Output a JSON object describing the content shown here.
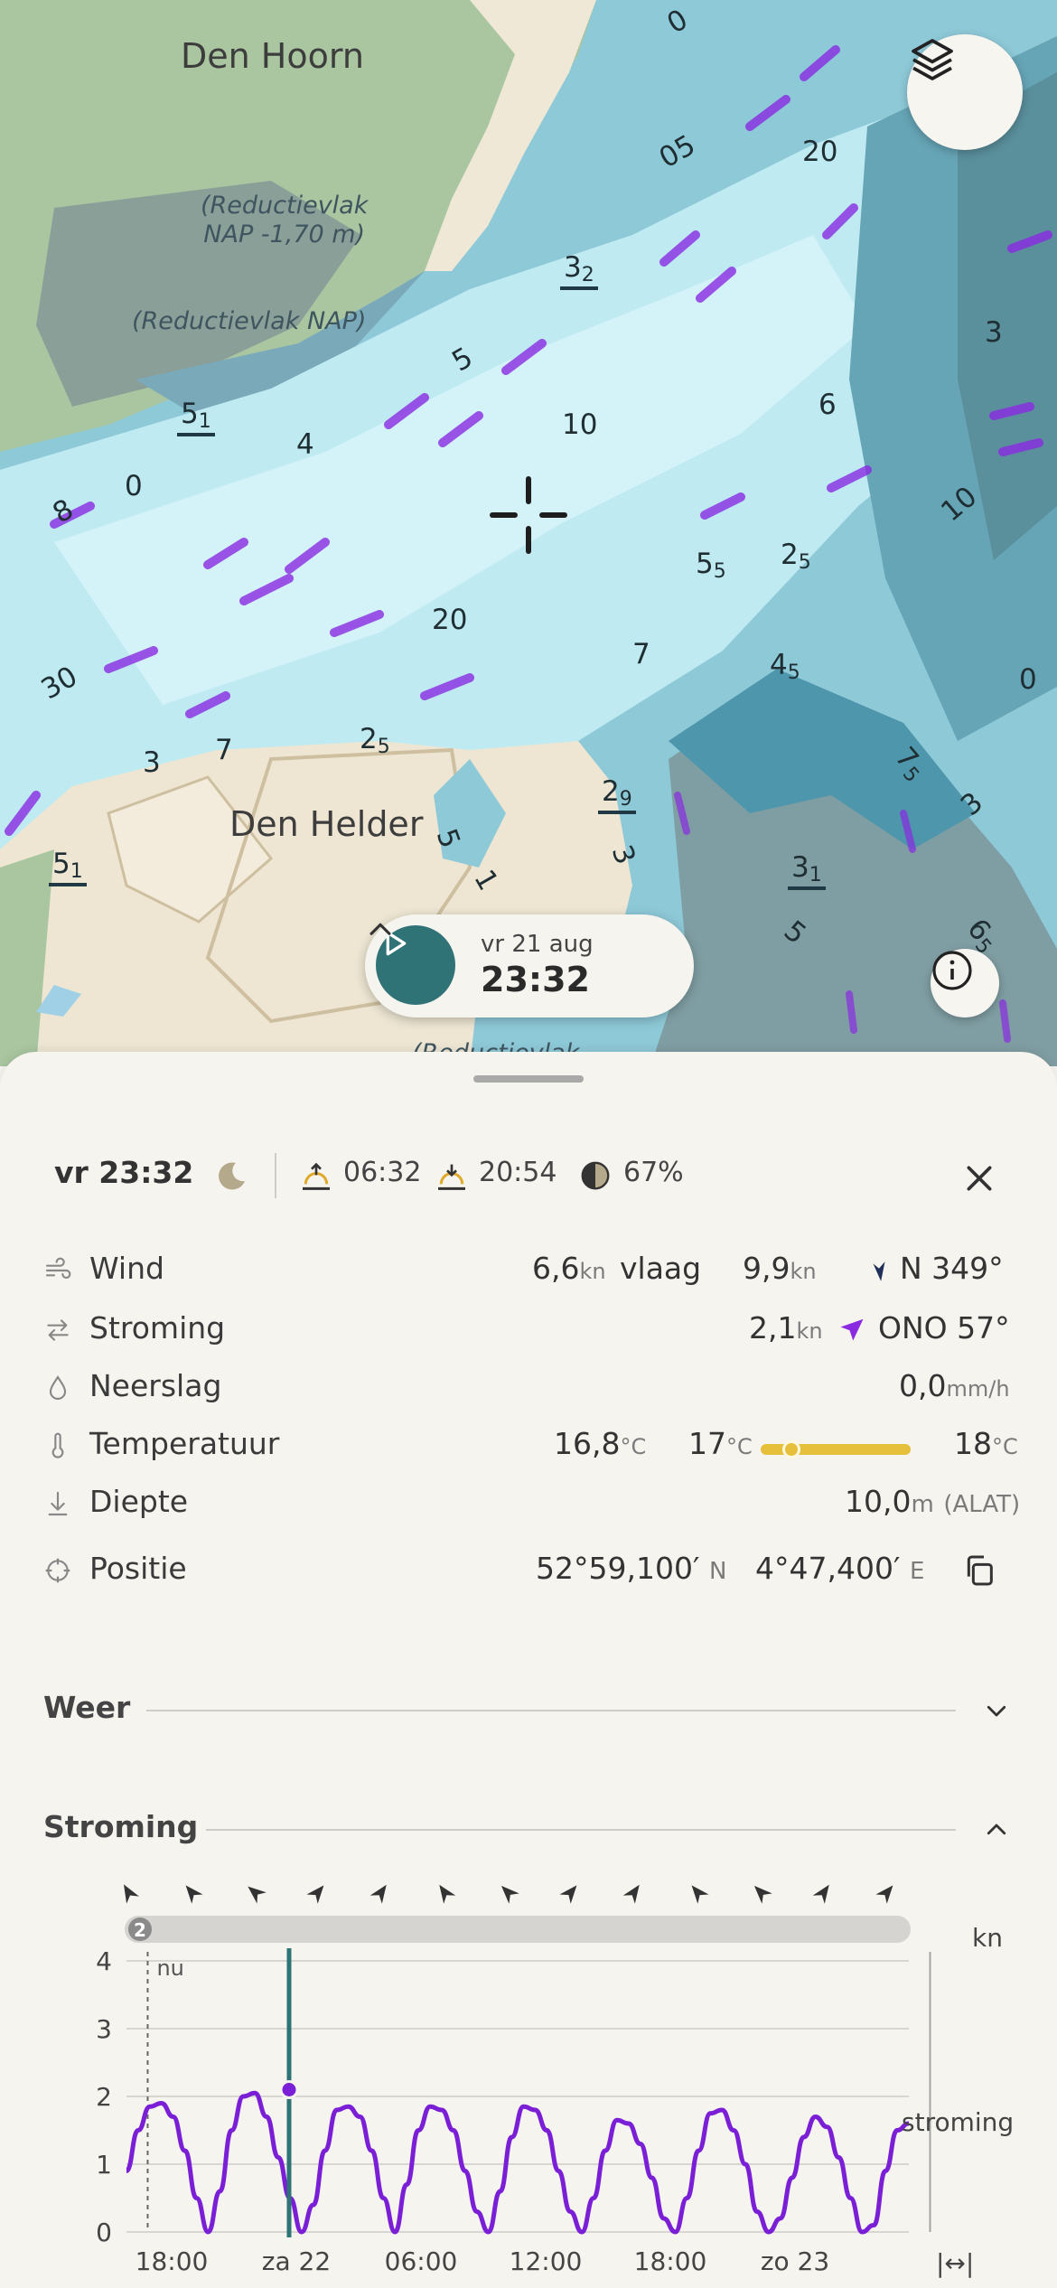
{
  "map": {
    "places": [
      {
        "name": "Den Hoorn"
      },
      {
        "name": "Den Helder"
      }
    ],
    "reduction_labels": [
      {
        "text": "(Reductievlak\nNAP -1,70 m)"
      },
      {
        "text": "(Reductievlak NAP)"
      },
      {
        "text": "(Reductievlak"
      }
    ],
    "depths": [
      "0",
      "5",
      "20",
      "3",
      "2",
      "5",
      "5",
      "10",
      "6",
      "3",
      "5",
      "1",
      "4",
      "0",
      "8",
      "6",
      "5",
      "10",
      "5",
      "5",
      "2",
      "5",
      "20",
      "7",
      "4",
      "5",
      "0",
      "30",
      "3",
      "7",
      "2",
      "5",
      "7",
      "5",
      "2",
      "9",
      "3",
      "5",
      "3",
      "5",
      "1",
      "3",
      "1",
      "1",
      "5",
      "6",
      "5",
      "0",
      "5"
    ],
    "icons": {
      "layers": "layers-icon",
      "crosshair": "crosshair-icon",
      "info": "info-icon",
      "play": "play-icon",
      "chevron": "chevron-up-icon"
    }
  },
  "time_pill": {
    "date": "vr 21 aug",
    "time": "23:32"
  },
  "summary": {
    "time": "vr 23:32",
    "sunrise": "06:32",
    "sunset": "20:54",
    "moon_illumination": "67%"
  },
  "details": {
    "wind": {
      "label": "Wind",
      "speed": "6,6",
      "speed_unit": "kn",
      "gust_label": "vlaag",
      "gust": "9,9",
      "gust_unit": "kn",
      "direction": "N 349°",
      "arrow_color": "#1f2f5a"
    },
    "current": {
      "label": "Stroming",
      "speed": "2,1",
      "speed_unit": "kn",
      "direction": "ONO 57°",
      "arrow_color": "#8a2be2"
    },
    "precipitation": {
      "label": "Neerslag",
      "value": "0,0",
      "unit": "mm/h"
    },
    "temperature": {
      "label": "Temperatuur",
      "value": "16,8",
      "unit": "°C",
      "min": "17",
      "max": "18",
      "min_unit": "°C",
      "max_unit": "°C",
      "bar_color": "#e6c03a"
    },
    "depth": {
      "label": "Diepte",
      "value": "10,0",
      "unit": "m",
      "datum": "(ALAT)"
    },
    "position": {
      "label": "Positie",
      "lat": "52°59,100′",
      "lat_hem": "N",
      "lon": "4°47,400′",
      "lon_hem": "E"
    }
  },
  "sections": {
    "weather": "Weer",
    "current": "Stroming"
  },
  "chart_data": {
    "type": "line",
    "title": "",
    "ylabel": "kn",
    "series_label": "stroming",
    "now_label": "nu",
    "gauge_value": "2",
    "ylim": [
      0,
      4
    ],
    "yticks": [
      "0",
      "1",
      "2",
      "3",
      "4"
    ],
    "xticks": [
      "18:00",
      "za 22",
      "06:00",
      "12:00",
      "18:00",
      "zo 23"
    ],
    "x_hours": [
      16,
      17,
      18,
      19,
      20,
      21,
      22,
      23,
      24,
      25,
      26,
      27,
      28,
      29,
      30,
      31,
      32,
      33,
      34,
      35,
      36,
      37,
      38,
      39,
      40,
      41,
      42,
      43,
      44,
      45,
      46,
      47,
      48,
      49,
      50,
      51,
      52,
      53,
      54,
      55,
      56,
      57,
      58,
      59,
      60,
      61,
      62,
      63,
      64,
      65,
      66,
      67,
      68,
      69,
      70,
      71,
      72,
      73,
      74,
      75,
      76,
      77,
      78,
      79,
      80,
      81,
      82,
      83
    ],
    "values": [
      0.9,
      1.5,
      1.85,
      1.9,
      1.7,
      1.2,
      0.5,
      0.0,
      0.6,
      1.5,
      2.0,
      2.05,
      1.7,
      1.1,
      0.5,
      0.0,
      0.4,
      1.2,
      1.8,
      1.85,
      1.7,
      1.2,
      0.5,
      0.0,
      0.7,
      1.5,
      1.85,
      1.8,
      1.5,
      0.9,
      0.3,
      0.0,
      0.6,
      1.4,
      1.85,
      1.8,
      1.5,
      0.9,
      0.3,
      0.0,
      0.5,
      1.2,
      1.65,
      1.6,
      1.3,
      0.8,
      0.2,
      0.0,
      0.5,
      1.2,
      1.75,
      1.8,
      1.5,
      1.0,
      0.3,
      0.0,
      0.2,
      0.8,
      1.4,
      1.7,
      1.55,
      1.1,
      0.5,
      0.0,
      0.1,
      0.9,
      1.5,
      1.6
    ],
    "now_hour": 18,
    "selected_hour": 23.5,
    "selected_value": 2.1,
    "marker_hour": 67,
    "line_color": "#7b1fd6",
    "direction_arrows": [
      "arrow-icon",
      "arrow-icon",
      "arrow-icon",
      "arrow-icon",
      "arrow-icon",
      "arrow-icon",
      "arrow-icon",
      "arrow-icon",
      "arrow-icon",
      "arrow-icon",
      "arrow-icon",
      "arrow-icon",
      "arrow-icon"
    ],
    "direction_angles": [
      -30,
      -40,
      -50,
      40,
      35,
      -35,
      -45,
      40,
      35,
      -40,
      -45,
      35,
      40
    ]
  }
}
